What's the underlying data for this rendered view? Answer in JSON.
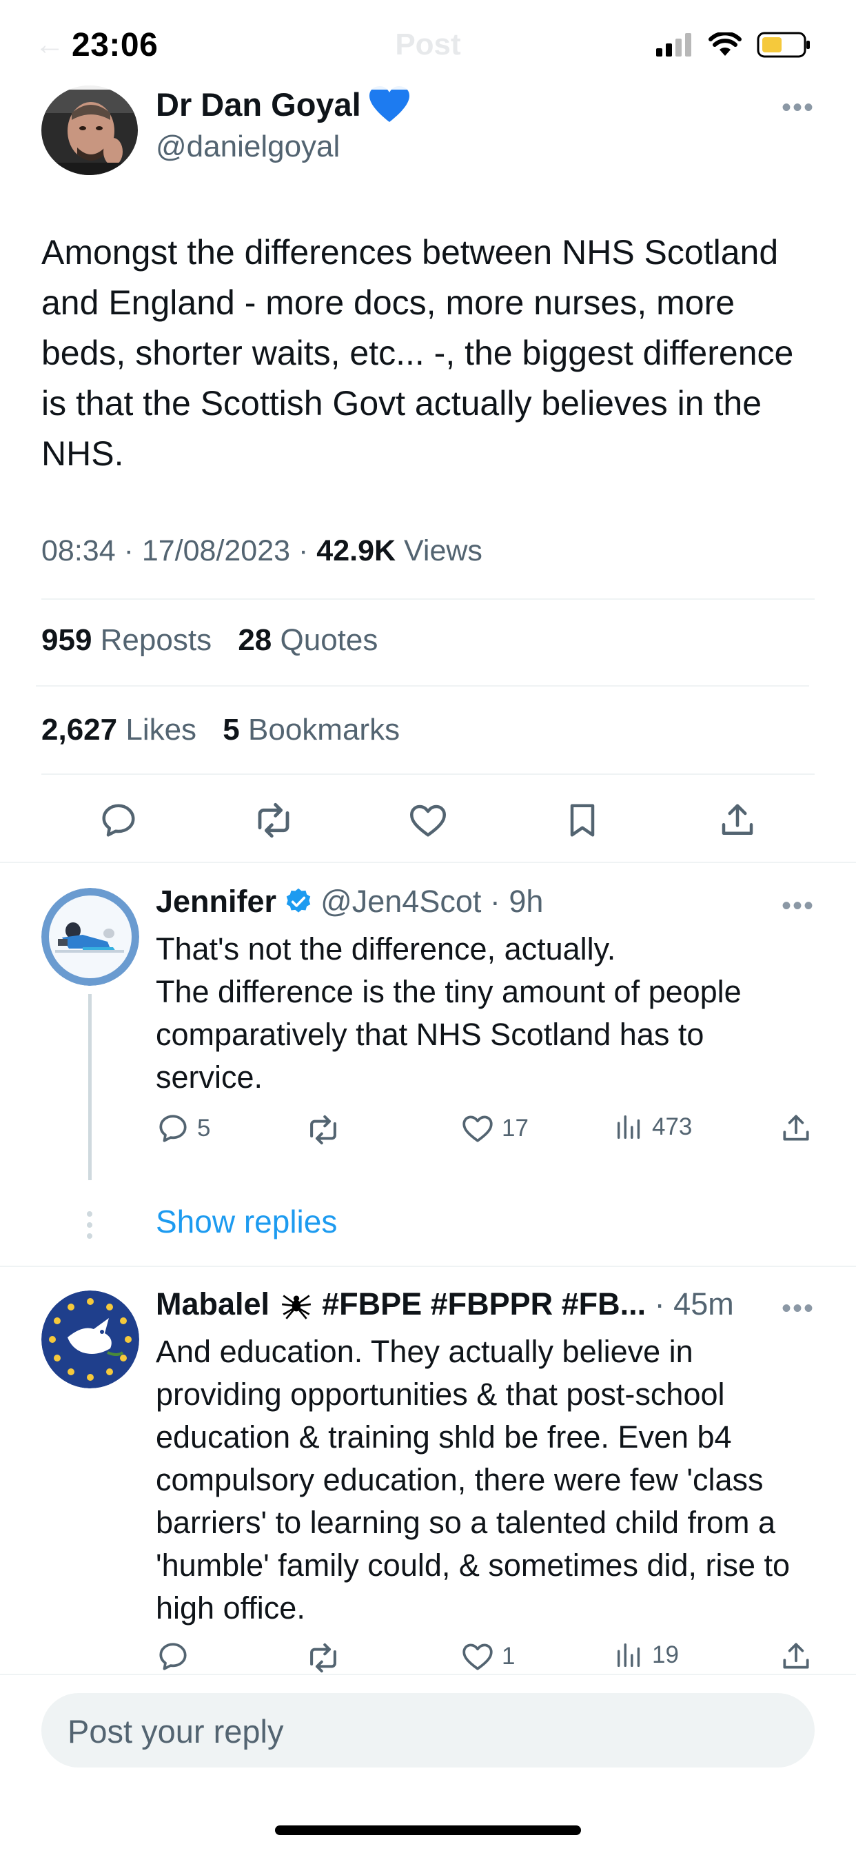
{
  "status_bar": {
    "time": "23:06",
    "nav_title": "Post"
  },
  "main_tweet": {
    "author_name": "Dr Dan Goyal",
    "author_badge": "💙",
    "handle": "@danielgoyal",
    "text": "Amongst the differences between NHS Scotland and England - more docs, more nurses, more beds, shorter waits, etc... -, the biggest difference is that the Scottish Govt actually believes in the NHS.",
    "time": "08:34",
    "date": "17/08/2023",
    "views_count": "42.9K",
    "views_label": "Views",
    "reposts_count": "959",
    "reposts_label": "Reposts",
    "quotes_count": "28",
    "quotes_label": "Quotes",
    "likes_count": "2,627",
    "likes_label": "Likes",
    "bookmarks_count": "5",
    "bookmarks_label": "Bookmarks"
  },
  "replies": [
    {
      "name": "Jennifer",
      "handle": "@Jen4Scot",
      "time": "9h",
      "text": "That's not the difference, actually.\nThe difference is the tiny amount of people comparatively that NHS Scotland has to service.",
      "reply_count": "5",
      "repost_count": "",
      "like_count": "17",
      "view_count": "473"
    },
    {
      "name": "Mabalel",
      "name_suffix": "#FBPE #FBPPR #FB...",
      "time": "45m",
      "text": "And education. They actually believe in providing opportunities & that post-school education &  training shld be free. Even b4 compulsory education, there were few 'class barriers' to learning so a talented child from a 'humble' family could, & sometimes did, rise to high office.",
      "reply_count": "",
      "repost_count": "",
      "like_count": "1",
      "view_count": "19"
    }
  ],
  "show_replies_label": "Show replies",
  "reply_box": {
    "placeholder": "Post your reply"
  },
  "colors": {
    "link": "#1d9bf0",
    "secondary_text": "#536471",
    "verified": "#1d9bf0"
  }
}
